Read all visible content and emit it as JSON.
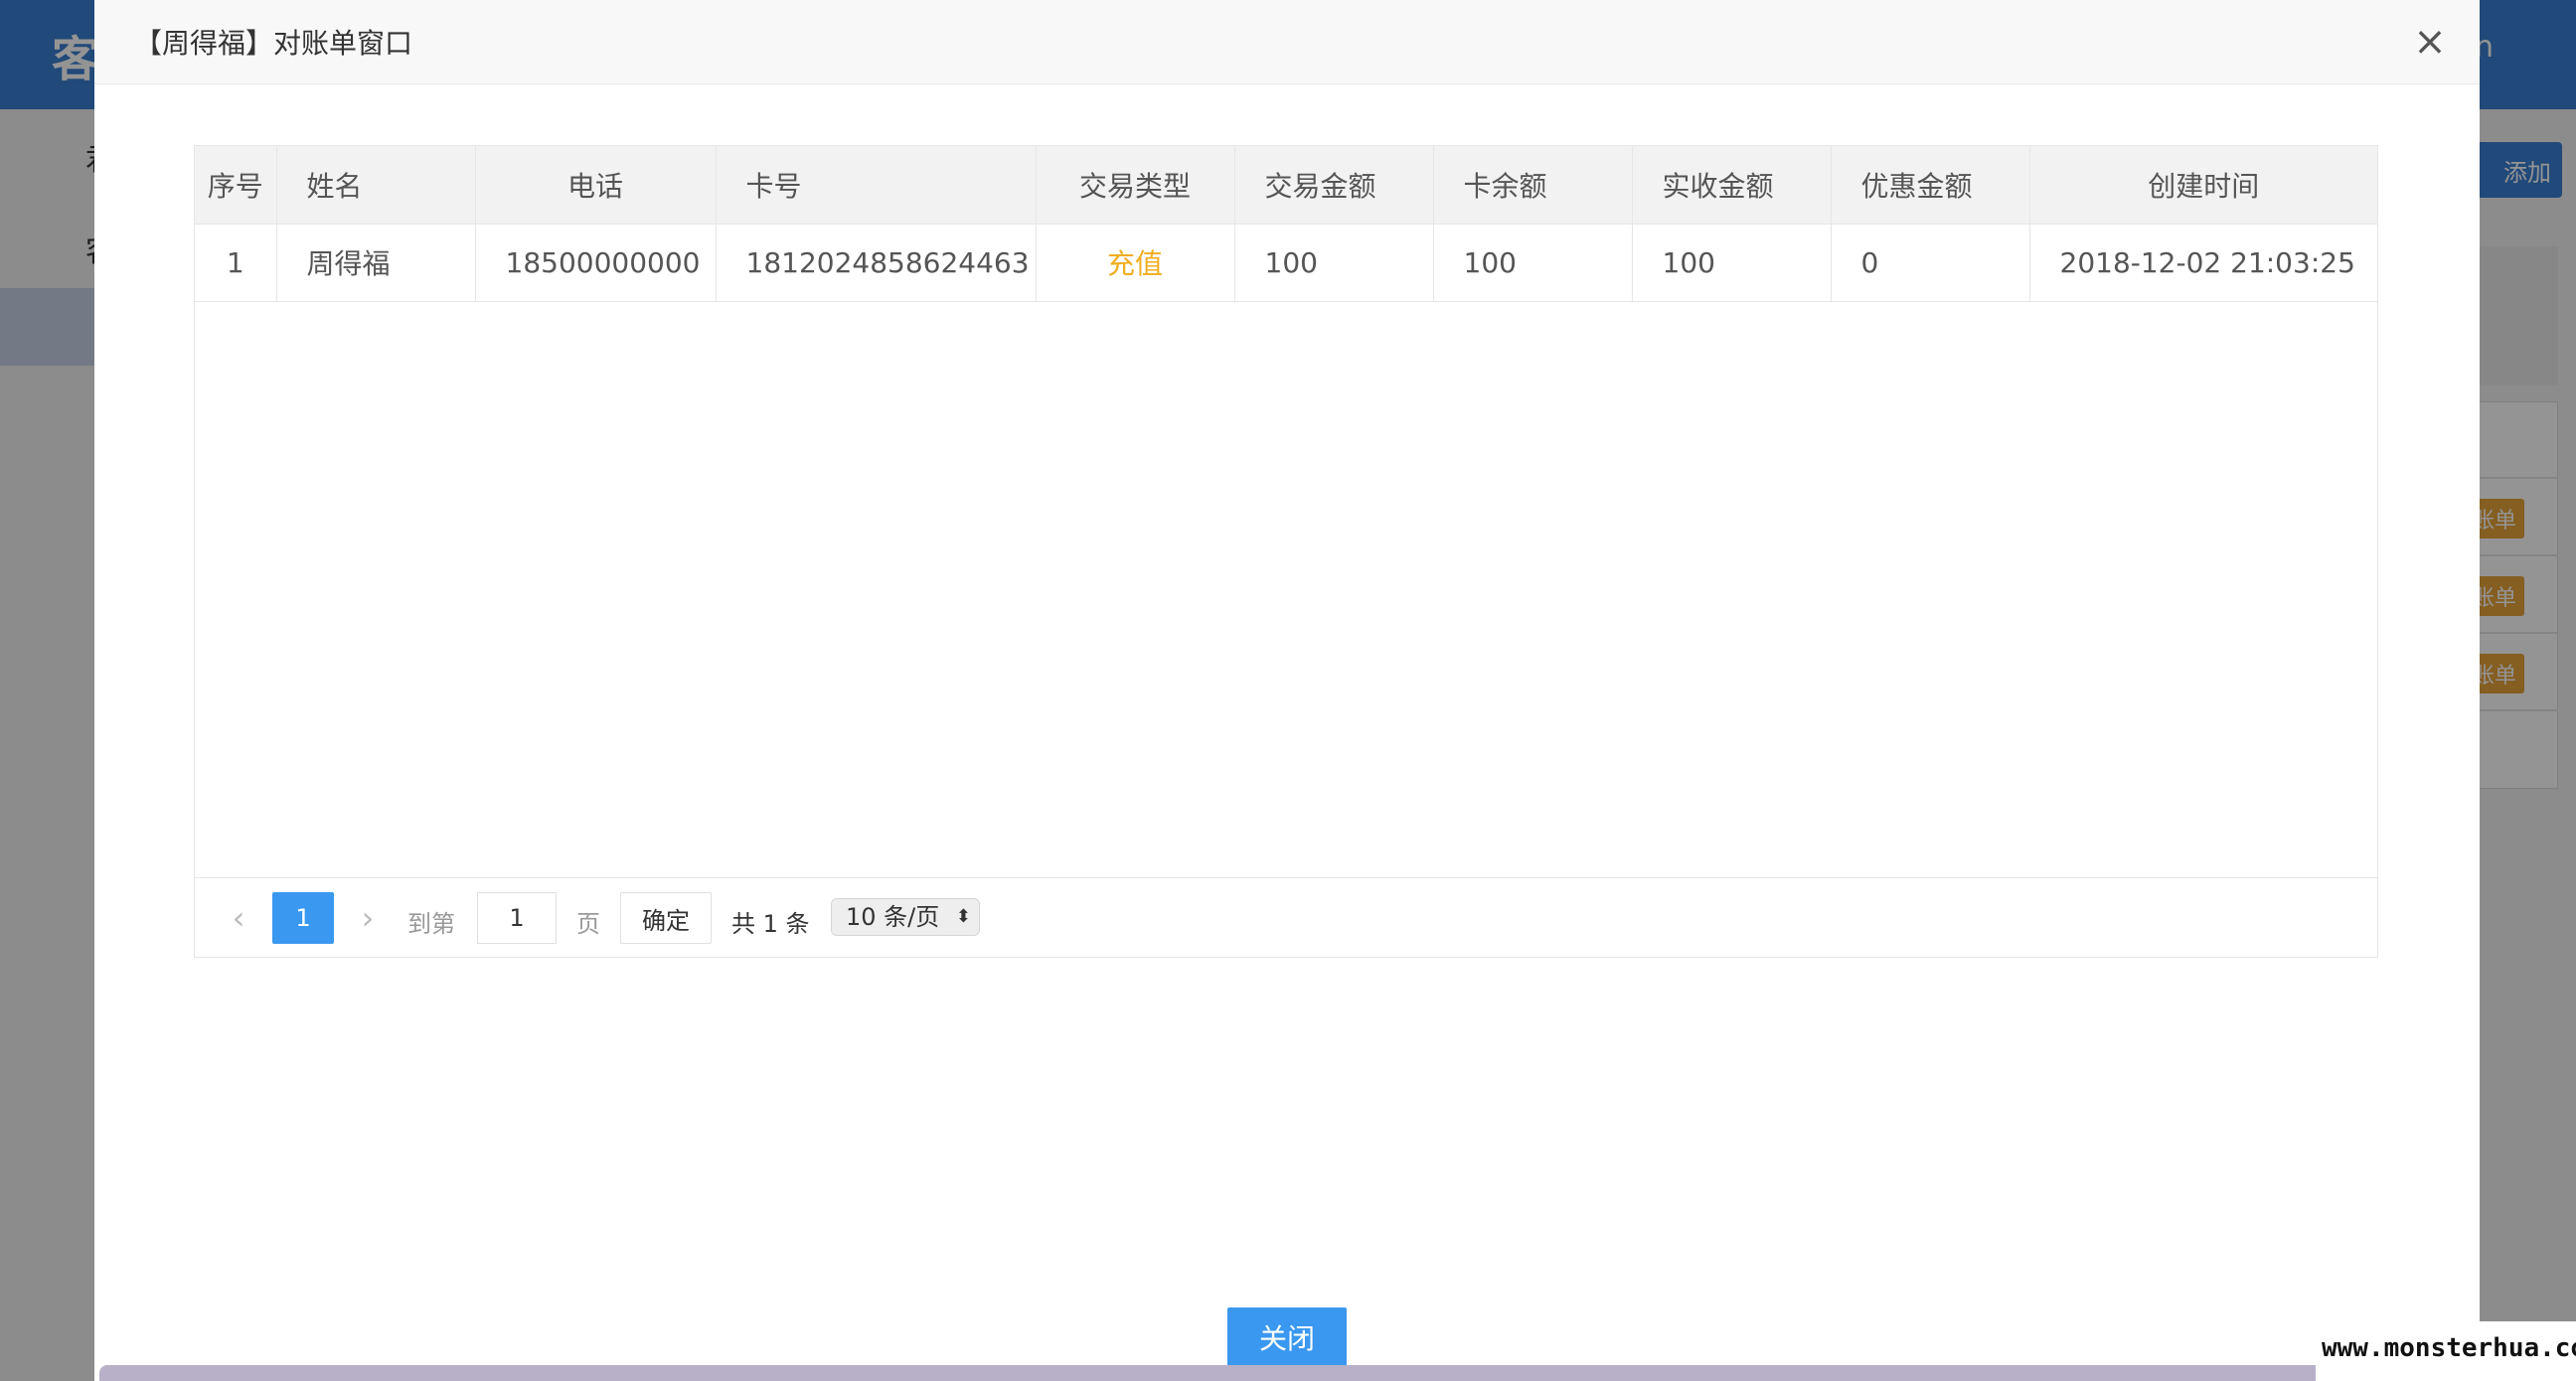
{
  "background": {
    "brand_char": "客",
    "header_right": "n",
    "side_items": [
      "君",
      "客"
    ],
    "add_button": "添加",
    "bill_buttons": [
      "账单",
      "账单",
      "账单"
    ]
  },
  "modal": {
    "title": "【周得福】对账单窗口",
    "close_icon": "×",
    "table": {
      "columns": [
        "序号",
        "姓名",
        "电话",
        "卡号",
        "交易类型",
        "交易金额",
        "卡余额",
        "实收金额",
        "优惠金额",
        "创建时间"
      ],
      "rows": [
        {
          "index": "1",
          "name": "周得福",
          "phone": "18500000000",
          "card_no": "1812024858624463",
          "type": "充值",
          "amount": "100",
          "balance": "100",
          "received": "100",
          "discount": "0",
          "created_at": "2018-12-02 21:03:25"
        }
      ]
    },
    "pager": {
      "prev": "‹",
      "current": "1",
      "next": "›",
      "goto_label": "到第",
      "goto_value": "1",
      "page_label": "页",
      "confirm": "确定",
      "total": "共 1 条",
      "page_size": "10 条/页",
      "page_size_arrow": "⬍"
    },
    "footer": {
      "close_button": "关闭"
    }
  },
  "watermark": "www.monsterhua.com",
  "colors": {
    "primary": "#3a98f0",
    "recharge": "#f0ad1f",
    "header_bg": "#3a7fd0"
  }
}
